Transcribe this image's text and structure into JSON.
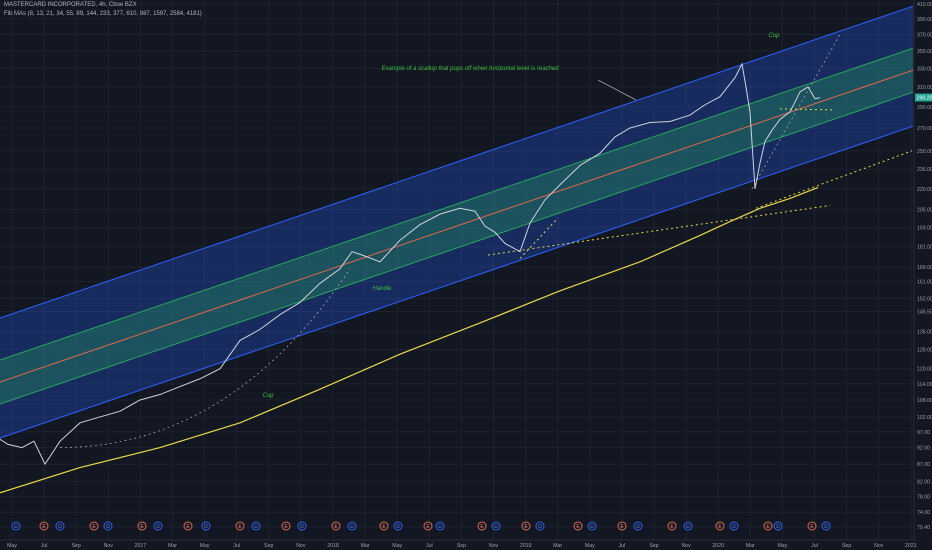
{
  "header": {
    "title": "MASTERCARD INCORPORATED, 4h, Cboe BZX",
    "indicator": "Fib MAs (8, 13, 21, 34, 55, 89, 144, 233, 377, 610, 987, 1597, 2584, 4181)"
  },
  "colors": {
    "background": "#131722",
    "outer_channel": "#2962ff",
    "inner_channel": "#26a65b",
    "midline": "#e0684a",
    "moving_average": "#e8d84a",
    "trendline": "#e8d84a",
    "annotation": "#3bbf3b",
    "price_line": "#cfd3dc",
    "last_price_badge": "#26a69a"
  },
  "chart_data": {
    "type": "line",
    "scale": "log",
    "ylim": [
      70.4,
      410
    ],
    "y_ticks": [
      70.4,
      74.0,
      78.0,
      82.0,
      87.0,
      92.0,
      97.0,
      102.0,
      108.0,
      114.0,
      120.0,
      128.0,
      136.0,
      145.5,
      152.0,
      161.0,
      169.0,
      181.0,
      193.0,
      205.0,
      220.0,
      235.0,
      250.0,
      270.0,
      290.0,
      310.0,
      330.0,
      350.0,
      370.0,
      390.0,
      410.0
    ],
    "x_ticks": [
      "May",
      "Jul",
      "Sep",
      "Nov",
      "2017",
      "Mar",
      "May",
      "Jul",
      "Sep",
      "Nov",
      "2018",
      "Mar",
      "May",
      "Jul",
      "Sep",
      "Nov",
      "2019",
      "Mar",
      "May",
      "Jul",
      "Sep",
      "Nov",
      "2020",
      "Mar",
      "May",
      "Jul",
      "Sep",
      "Nov",
      "2021"
    ],
    "last_price": "299.20",
    "series": [
      {
        "values": [
          [
            -2,
            95
          ],
          [
            8,
            93
          ],
          [
            22,
            92
          ],
          [
            34,
            94
          ],
          [
            45,
            87
          ],
          [
            60,
            94
          ],
          [
            80,
            100
          ],
          [
            100,
            102
          ],
          [
            120,
            104
          ],
          [
            140,
            108
          ],
          [
            160,
            110
          ],
          [
            180,
            113
          ],
          [
            200,
            116
          ],
          [
            220,
            120
          ],
          [
            240,
            132
          ],
          [
            260,
            137
          ],
          [
            280,
            144
          ],
          [
            300,
            150
          ],
          [
            320,
            160
          ],
          [
            340,
            168
          ],
          [
            352,
            178
          ],
          [
            362,
            176
          ],
          [
            380,
            172
          ],
          [
            400,
            185
          ],
          [
            420,
            195
          ],
          [
            440,
            202
          ],
          [
            460,
            206
          ],
          [
            475,
            204
          ],
          [
            485,
            194
          ],
          [
            495,
            190
          ],
          [
            505,
            183
          ],
          [
            520,
            178
          ],
          [
            530,
            196
          ],
          [
            545,
            212
          ],
          [
            560,
            223
          ],
          [
            580,
            238
          ],
          [
            600,
            248
          ],
          [
            615,
            262
          ],
          [
            630,
            270
          ],
          [
            650,
            275
          ],
          [
            670,
            276
          ],
          [
            690,
            282
          ],
          [
            705,
            292
          ],
          [
            720,
            300
          ],
          [
            735,
            320
          ],
          [
            742,
            335
          ],
          [
            746,
            310
          ],
          [
            750,
            285
          ],
          [
            755,
            220
          ],
          [
            760,
            240
          ],
          [
            765,
            258
          ],
          [
            772,
            268
          ],
          [
            780,
            278
          ],
          [
            790,
            285
          ],
          [
            800,
            305
          ],
          [
            808,
            310
          ],
          [
            815,
            298
          ],
          [
            820,
            299
          ]
        ]
      },
      {
        "values": [
          [
            0,
            79
          ],
          [
            80,
            86
          ],
          [
            160,
            92
          ],
          [
            240,
            100
          ],
          [
            320,
            112
          ],
          [
            400,
            126
          ],
          [
            480,
            140
          ],
          [
            560,
            156
          ],
          [
            640,
            172
          ],
          [
            700,
            188
          ],
          [
            730,
            197
          ],
          [
            760,
            206
          ],
          [
            790,
            213
          ],
          [
            818,
            221
          ]
        ]
      }
    ],
    "annotations": [
      "Example of a scallop that pops off when horizontal level is reached",
      "Cup",
      "Handle",
      "Cup"
    ],
    "event_markers": [
      "D",
      "E",
      "D",
      "E",
      "D",
      "E",
      "D",
      "E",
      "D",
      "E",
      "D",
      "E",
      "D",
      "E",
      "D",
      "E",
      "D",
      "E",
      "D",
      "E",
      "D",
      "E",
      "D",
      "E",
      "D",
      "E",
      "D",
      "E",
      "D",
      "E",
      "D",
      "E",
      "D",
      "E",
      "D",
      "E"
    ]
  }
}
